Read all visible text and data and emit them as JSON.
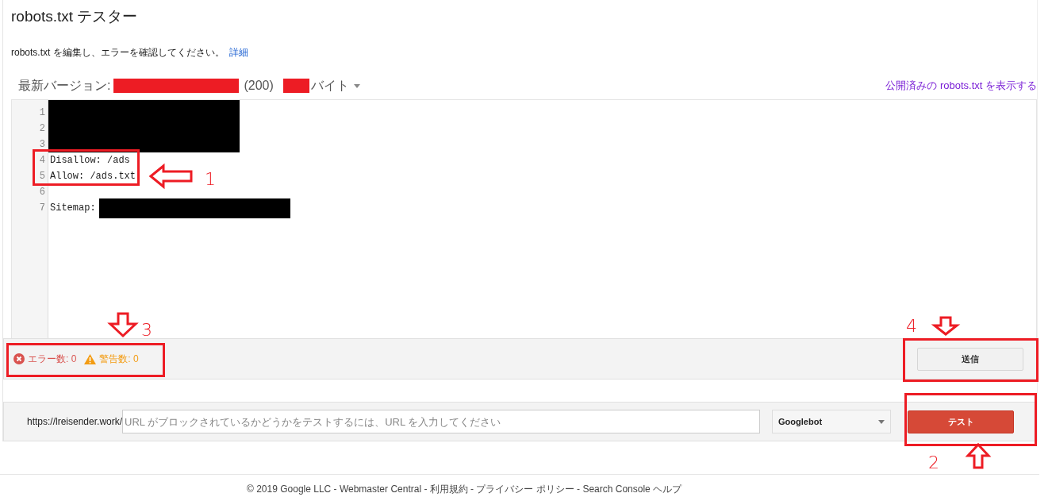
{
  "title": "robots.txt テスター",
  "intro": {
    "text": "robots.txt を編集し、エラーを確認してください。",
    "link": "詳細"
  },
  "version": {
    "label": "最新バージョン:",
    "status": "(200)",
    "unit": "バイト"
  },
  "published_link": "公開済みの robots.txt を表示する",
  "editor": {
    "lines": [
      {
        "number": "1",
        "kind": "redacted"
      },
      {
        "number": "2",
        "kind": "redacted"
      },
      {
        "number": "3",
        "kind": "redacted"
      },
      {
        "number": "4",
        "kind": "code",
        "text": "Disallow: /ads"
      },
      {
        "number": "5",
        "kind": "code",
        "text": "Allow: /ads.txt"
      },
      {
        "number": "6",
        "kind": "blank"
      },
      {
        "number": "7",
        "kind": "code_redacted",
        "text": "Sitemap:"
      }
    ]
  },
  "counts": {
    "errors": "エラー数: 0",
    "warnings": "警告数: 0"
  },
  "submit_button": "送信",
  "url_test": {
    "prefix": "https://lreisender.work/",
    "placeholder": "URL がブロックされているかどうかをテストするには、URL を入力してください",
    "agent": "Googlebot",
    "test_button": "テスト"
  },
  "footer": "© 2019 Google LLC - Webmaster Central - 利用規約 - プライバシー ポリシー - Search Console ヘルプ",
  "annotations": [
    {
      "label": "1"
    },
    {
      "label": "2"
    },
    {
      "label": "3"
    },
    {
      "label": "4"
    }
  ]
}
